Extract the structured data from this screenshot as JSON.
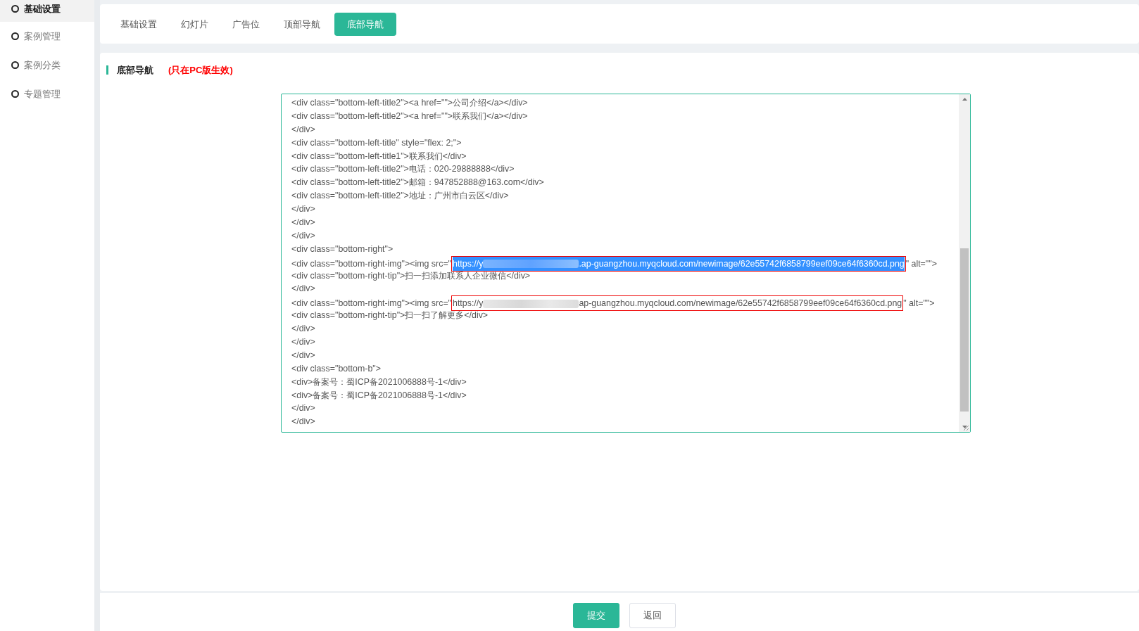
{
  "sidebar": {
    "items": [
      {
        "label": "基础设置",
        "selected": true
      },
      {
        "label": "案例管理",
        "selected": false
      },
      {
        "label": "案例分类",
        "selected": false
      },
      {
        "label": "专题管理",
        "selected": false
      }
    ]
  },
  "tabs": [
    {
      "label": "基础设置",
      "selected": false
    },
    {
      "label": "幻灯片",
      "selected": false
    },
    {
      "label": "广告位",
      "selected": false
    },
    {
      "label": "顶部导航",
      "selected": false
    },
    {
      "label": "底部导航",
      "selected": true
    }
  ],
  "section": {
    "title": "底部导航",
    "note": "(只在PC版生效)"
  },
  "editor": {
    "lines": [
      {
        "kind": "text",
        "text": "<div class=\"bottom-left-title2\"><a href=\"\">公司介绍</a></div>"
      },
      {
        "kind": "text",
        "text": "<div class=\"bottom-left-title2\"><a href=\"\">联系我们</a></div>"
      },
      {
        "kind": "text",
        "text": "</div>"
      },
      {
        "kind": "text",
        "text": "<div class=\"bottom-left-title\" style=\"flex: 2;\">"
      },
      {
        "kind": "text",
        "text": "<div class=\"bottom-left-title1\">联系我们</div>"
      },
      {
        "kind": "text",
        "text": "<div class=\"bottom-left-title2\">电话：020-29888888</div>"
      },
      {
        "kind": "text",
        "text": "<div class=\"bottom-left-title2\">邮箱：947852888@163.com</div>"
      },
      {
        "kind": "text",
        "text": "<div class=\"bottom-left-title2\">地址：广州市白云区</div>"
      },
      {
        "kind": "text",
        "text": "</div>"
      },
      {
        "kind": "text",
        "text": "</div>"
      },
      {
        "kind": "text",
        "text": "</div>"
      },
      {
        "kind": "text",
        "text": "<div class=\"bottom-right\">"
      },
      {
        "kind": "url",
        "prefix": "<div class=\"bottom-right-img\"><img src=\"",
        "url_start": "https://y",
        "url_end": ".ap-guangzhou.myqcloud.com/newimage/62e55742f6858799eef09ce64f6360cd.png",
        "suffix": "\" alt=\"\">",
        "selected": true,
        "annotated": true
      },
      {
        "kind": "text",
        "text": "<div class=\"bottom-right-tip\">扫一扫添加联系人企业微信</div>"
      },
      {
        "kind": "text",
        "text": "</div>"
      },
      {
        "kind": "url",
        "prefix": "<div class=\"bottom-right-img\"><img src=\"",
        "url_start": "https://y",
        "url_end": "ap-guangzhou.myqcloud.com/newimage/62e55742f6858799eef09ce64f6360cd.png",
        "suffix": "\" alt=\"\">",
        "selected": false,
        "annotated": true
      },
      {
        "kind": "text",
        "text": "<div class=\"bottom-right-tip\">扫一扫了解更多</div>"
      },
      {
        "kind": "text",
        "text": "</div>"
      },
      {
        "kind": "text",
        "text": "</div>"
      },
      {
        "kind": "text",
        "text": "</div>"
      },
      {
        "kind": "text",
        "text": "<div class=\"bottom-b\">"
      },
      {
        "kind": "text",
        "text": "<div>备案号：蜀ICP备2021006888号-1</div>"
      },
      {
        "kind": "text",
        "text": "<div>备案号：蜀ICP备2021006888号-1</div>"
      },
      {
        "kind": "text",
        "text": "</div>"
      },
      {
        "kind": "text",
        "text": "</div>"
      }
    ]
  },
  "buttons": [
    {
      "kind": "primary",
      "label": "提交"
    },
    {
      "kind": "default",
      "label": "返回"
    }
  ]
}
